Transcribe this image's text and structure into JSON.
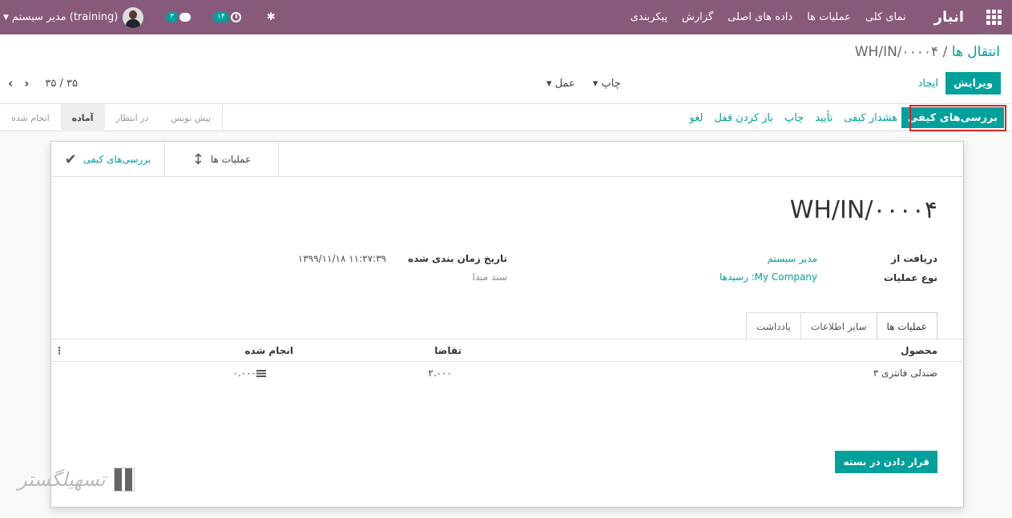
{
  "topbar": {
    "brand": "انبار",
    "menu": [
      "نمای کلی",
      "عملیات ها",
      "داده های اصلی",
      "گزارش",
      "پیکربندی"
    ],
    "user_name": "مدیر سیستم (training)",
    "chat_count": "۳",
    "activity_count": "۱۴",
    "colors": {
      "bar": "#875a7b",
      "accent": "#00a09d"
    }
  },
  "control": {
    "breadcrumb_parent": "انتقال ها",
    "breadcrumb_sep": "/",
    "breadcrumb_current": "WH/IN/۰۰۰۰۴",
    "edit_label": "ویرایش",
    "create_label": "ایجاد",
    "print_dropdown": "چاپ",
    "action_dropdown": "عمل",
    "pager": "۳۵ / ۳۵"
  },
  "statusbar": {
    "quality_button": "بررسی‌های کیفی",
    "actions": [
      "هشدار کیفی",
      "تأیید",
      "چاپ",
      "باز کردن قفل",
      "لغو"
    ],
    "stages": [
      "انجام شده",
      "آماده",
      "در انتظار",
      "پیش نویس"
    ],
    "active_stage": "آماده"
  },
  "sheet": {
    "smart_quality": "بررسی‌های کیفی",
    "smart_ops": "عملیات ها",
    "title": "WH/IN/۰۰۰۰۴",
    "receive_from_label": "دریافت از",
    "receive_from_value": "مدیر سیستم",
    "op_type_label": "نوع عملیات",
    "op_type_value": "My Company: رسیدها",
    "scheduled_label": "تاریخ زمان بندی شده",
    "scheduled_value": "۱۳۹۹/۱۱/۱۸ ۱۱:۲۷:۳۹",
    "source_doc_label": "سند مبدا",
    "tabs": [
      "عملیات ها",
      "سایر اطلاعات",
      "یادداشت"
    ],
    "table": {
      "headers": {
        "product": "محصول",
        "demand": "تقاضا",
        "done": "انجام شده"
      },
      "rows": [
        {
          "product": "صندلی فانتزی ۳",
          "demand": "۲.۰۰۰",
          "done": "۰.۰۰۰"
        }
      ]
    },
    "pack_button": "قرار دادن در بسته"
  },
  "watermark": "تسهیلگستر"
}
